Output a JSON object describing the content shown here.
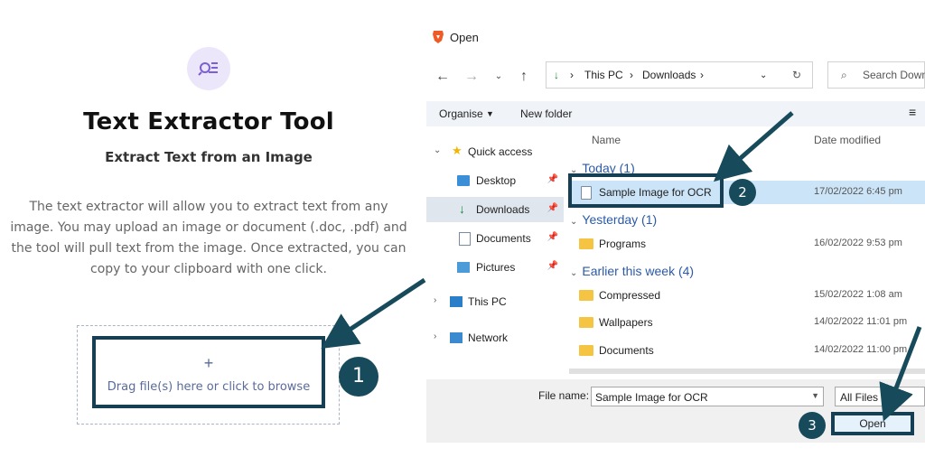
{
  "tool": {
    "title": "Text Extractor Tool",
    "subtitle": "Extract Text from an Image",
    "description_lines": [
      "The text extractor will allow you to extract text from any",
      "image. You may upload an image or document (.doc, .pdf) and",
      "the tool will pull text from the image. Once extracted, you can",
      "copy to your clipboard with one click."
    ],
    "drop_plus": "+",
    "drop_text": "Drag file(s) here or click to browse",
    "accent_color": "#ece6fb"
  },
  "annotations": {
    "step1": "1",
    "step2": "2",
    "step3": "3",
    "color": "#174a5a"
  },
  "dialog": {
    "title": "Open",
    "address": {
      "segment1": "This PC",
      "segment2": "Downloads"
    },
    "search_placeholder": "Search Down",
    "toolbar": {
      "organise": "Organise",
      "new_folder": "New folder"
    },
    "nav": [
      {
        "label": "Quick access",
        "icon": "star-icon"
      },
      {
        "label": "Desktop",
        "icon": "desktop-icon"
      },
      {
        "label": "Downloads",
        "icon": "download-icon",
        "selected": true
      },
      {
        "label": "Documents",
        "icon": "document-icon"
      },
      {
        "label": "Pictures",
        "icon": "picture-icon"
      },
      {
        "label": "This PC",
        "icon": "computer-icon"
      },
      {
        "label": "Network",
        "icon": "network-icon"
      }
    ],
    "columns": {
      "name": "Name",
      "date": "Date modified"
    },
    "groups": [
      {
        "label": "Today (1)",
        "files": [
          {
            "name": "Sample Image for OCR",
            "date": "17/02/2022 6:45 pm",
            "selected": true
          }
        ]
      },
      {
        "label": "Yesterday (1)",
        "files": [
          {
            "name": "Programs",
            "date": "16/02/2022 9:53 pm"
          }
        ]
      },
      {
        "label": "Earlier this week (4)",
        "files": [
          {
            "name": "Compressed",
            "date": "15/02/2022 1:08 am"
          },
          {
            "name": "Wallpapers",
            "date": "14/02/2022 11:01 pm"
          },
          {
            "name": "Documents",
            "date": "14/02/2022 11:00 pm"
          }
        ]
      }
    ],
    "footer": {
      "file_name_label": "File name:",
      "file_name_value": "Sample Image for OCR",
      "file_type": "All Files",
      "open_label": "Open"
    }
  }
}
